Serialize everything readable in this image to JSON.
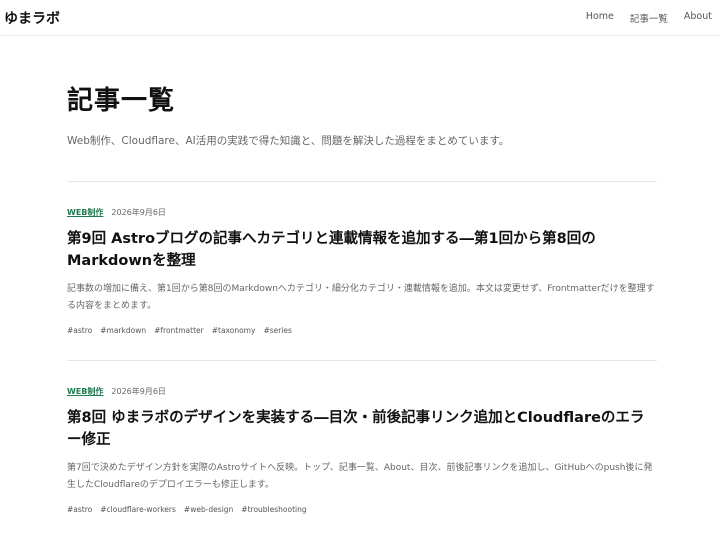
{
  "header": {
    "brand": "ゆまラボ",
    "nav": [
      {
        "label": "Home"
      },
      {
        "label": "記事一覧"
      },
      {
        "label": "About"
      }
    ]
  },
  "page": {
    "title": "記事一覧",
    "description": "Web制作、Cloudflare、AI活用の実践で得た知識と、問題を解決した過程をまとめています。"
  },
  "articles": [
    {
      "category": "WEB制作",
      "date": "2026年9月6日",
      "title": "第9回 Astroブログの記事へカテゴリと連載情報を追加する―第1回から第8回のMarkdownを整理",
      "excerpt": "記事数の増加に備え、第1回から第8回のMarkdownへカテゴリ・細分化カテゴリ・連載情報を追加。本文は変更せず、Frontmatterだけを整理する内容をまとめます。",
      "tags": [
        "#astro",
        "#markdown",
        "#frontmatter",
        "#taxonomy",
        "#series"
      ]
    },
    {
      "category": "WEB制作",
      "date": "2026年9月6日",
      "title": "第8回 ゆまラボのデザインを実装する―目次・前後記事リンク追加とCloudflareのエラー修正",
      "excerpt": "第7回で決めたデザイン方針を実際のAstroサイトへ反映。トップ、記事一覧、About、目次、前後記事リンクを追加し、GitHubへのpush後に発生したCloudflareのデプロイエラーも修正します。",
      "tags": [
        "#astro",
        "#cloudflare-workers",
        "#web-design",
        "#troubleshooting"
      ]
    }
  ]
}
